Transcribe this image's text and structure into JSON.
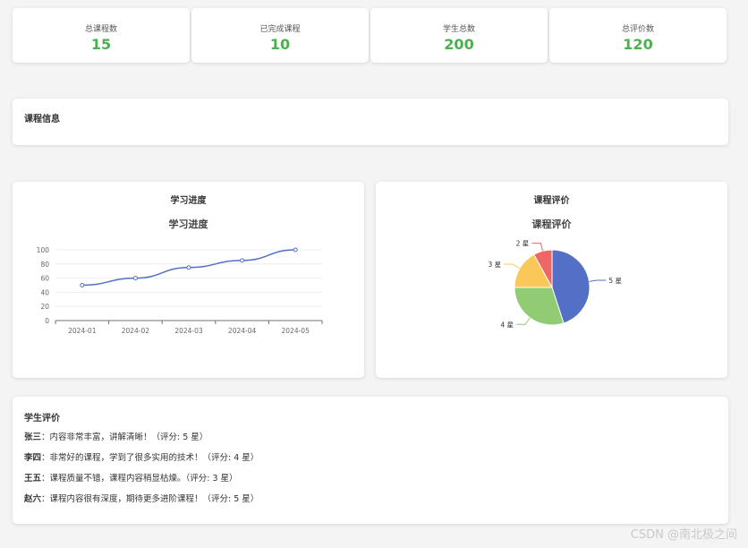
{
  "stats": [
    {
      "label": "总课程数",
      "value": "15"
    },
    {
      "label": "已完成课程",
      "value": "10"
    },
    {
      "label": "学生总数",
      "value": "200"
    },
    {
      "label": "总评价数",
      "value": "120"
    }
  ],
  "course_info": {
    "title": "课程信息"
  },
  "progress_card": {
    "header": "学习进度"
  },
  "rating_card": {
    "header": "课程评价"
  },
  "chart_data": [
    {
      "type": "line",
      "title": "学习进度",
      "x": [
        "2024-01",
        "2024-02",
        "2024-03",
        "2024-04",
        "2024-05"
      ],
      "series": [
        {
          "values": [
            50,
            60,
            75,
            85,
            100
          ]
        }
      ],
      "ylim": [
        0,
        100
      ],
      "yticks": [
        0,
        20,
        40,
        60,
        80,
        100
      ],
      "color": "#5470c6",
      "grid": true
    },
    {
      "type": "pie",
      "title": "课程评价",
      "categories": [
        "5 星",
        "4 星",
        "3 星",
        "2 星"
      ],
      "values": [
        45,
        30,
        17,
        8
      ],
      "colors": [
        "#5470c6",
        "#91cc75",
        "#fac858",
        "#ee6666"
      ]
    }
  ],
  "reviews": {
    "title": "学生评价",
    "items": [
      {
        "name": "张三",
        "text": "：内容非常丰富，讲解清晰！（评分: 5 星）"
      },
      {
        "name": "李四",
        "text": "：非常好的课程，学到了很多实用的技术！（评分: 4 星）"
      },
      {
        "name": "王五",
        "text": "：课程质量不错，课程内容稍显枯燥。（评分: 3 星）"
      },
      {
        "name": "赵六",
        "text": "：课程内容很有深度，期待更多进阶课程！（评分: 5 星）"
      }
    ]
  },
  "watermark": "CSDN @南北极之间"
}
